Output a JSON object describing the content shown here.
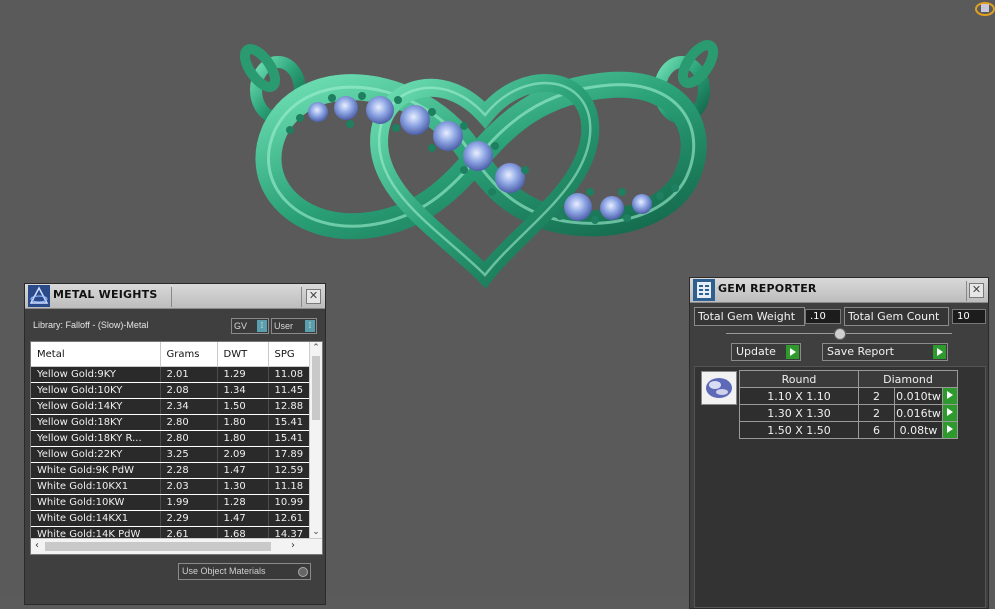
{
  "metal_weights": {
    "title": "METAL WEIGHTS",
    "library_label": "Library: Falloff - (Slow)-Metal",
    "gv_label": "GV",
    "user_label": "User",
    "columns": [
      "Metal",
      "Grams",
      "DWT",
      "SPG"
    ],
    "rows": [
      {
        "metal": "Yellow Gold:9KY",
        "grams": "2.01",
        "dwt": "1.29",
        "spg": "11.08"
      },
      {
        "metal": "Yellow Gold:10KY",
        "grams": "2.08",
        "dwt": "1.34",
        "spg": "11.45"
      },
      {
        "metal": "Yellow Gold:14KY",
        "grams": "2.34",
        "dwt": "1.50",
        "spg": "12.88"
      },
      {
        "metal": "Yellow Gold:18KY",
        "grams": "2.80",
        "dwt": "1.80",
        "spg": "15.41"
      },
      {
        "metal": "Yellow Gold:18KY R...",
        "grams": "2.80",
        "dwt": "1.80",
        "spg": "15.41"
      },
      {
        "metal": "Yellow Gold:22KY",
        "grams": "3.25",
        "dwt": "2.09",
        "spg": "17.89"
      },
      {
        "metal": "White Gold:9K PdW",
        "grams": "2.28",
        "dwt": "1.47",
        "spg": "12.59"
      },
      {
        "metal": "White Gold:10KX1",
        "grams": "2.03",
        "dwt": "1.30",
        "spg": "11.18"
      },
      {
        "metal": "White Gold:10KW",
        "grams": "1.99",
        "dwt": "1.28",
        "spg": "10.99"
      },
      {
        "metal": "White Gold:14KX1",
        "grams": "2.29",
        "dwt": "1.47",
        "spg": "12.61"
      },
      {
        "metal": "White Gold:14K PdW",
        "grams": "2.61",
        "dwt": "1.68",
        "spg": "14.37"
      }
    ],
    "use_object_materials": "Use Object Materials"
  },
  "gem_reporter": {
    "title": "GEM REPORTER",
    "total_weight_label": "Total Gem Weight",
    "total_weight_value": ".10",
    "total_count_label": "Total Gem Count",
    "total_count_value": "10",
    "update_label": "Update",
    "save_report_label": "Save Report",
    "headers": [
      "Round",
      "Diamond"
    ],
    "rows": [
      {
        "size": "1.10 X 1.10",
        "count": "2",
        "weight": "0.010tw"
      },
      {
        "size": "1.30 X 1.30",
        "count": "2",
        "weight": "0.016tw"
      },
      {
        "size": "1.50 X 1.50",
        "count": "6",
        "weight": "0.08tw"
      }
    ]
  },
  "colors": {
    "viewport": "#5a5a5a",
    "metal_green": "#2fa57a",
    "gem_blue": "#8fa8e6",
    "go_green": "#2e9a2e"
  }
}
